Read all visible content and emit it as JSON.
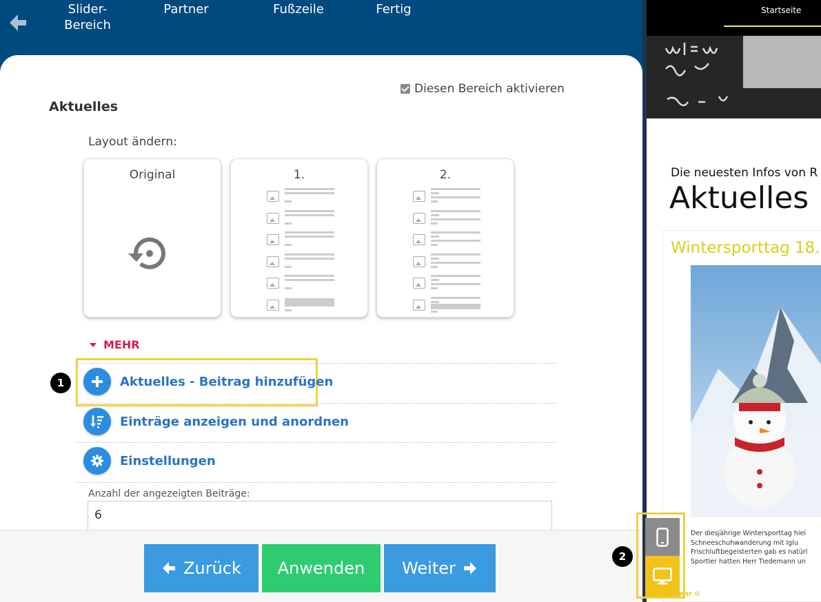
{
  "nav": {
    "steps": [
      "Slider-\nBereich",
      "Partner",
      "Fußzeile",
      "Fertig"
    ]
  },
  "section": {
    "title": "Aktuelles",
    "activate_label": "Diesen Bereich aktivieren",
    "activate_checked": true,
    "layout_label": "Layout ändern:",
    "layouts": [
      "Original",
      "1.",
      "2."
    ]
  },
  "more": {
    "label": "MEHR",
    "actions": {
      "add_post": "Aktuelles - Beitrag hinzufügen",
      "show_entries": "Einträge anzeigen und anordnen",
      "settings": "Einstellungen"
    }
  },
  "count": {
    "label": "Anzahl der angezeigten Beiträge:",
    "value": "6"
  },
  "footer": {
    "back": "Zurück",
    "apply": "Anwenden",
    "next": "Weiter"
  },
  "badges": {
    "one": "1",
    "two": "2"
  },
  "preview": {
    "nav_item": "Startseite",
    "subtitle": "Die neuesten Infos von R",
    "title": "Aktuelles",
    "post_title": "Wintersporttag 18.",
    "text_lines": [
      "Der diesjährige Wintersporttag hiel",
      "Schneeschuhwanderung mit Iglu",
      "Frischluftbegeisterten gab es natürl",
      "Sportler hatten Herr Tiedemann un"
    ],
    "more": "Mehr ⊙"
  },
  "colors": {
    "nav_bg": "#004a7f",
    "accent_blue": "#2a8de0",
    "apply_green": "#2ecc71",
    "mehr_red": "#d61e50",
    "highlight_yellow": "#f0d040",
    "preview_yellow": "#d8d018"
  }
}
